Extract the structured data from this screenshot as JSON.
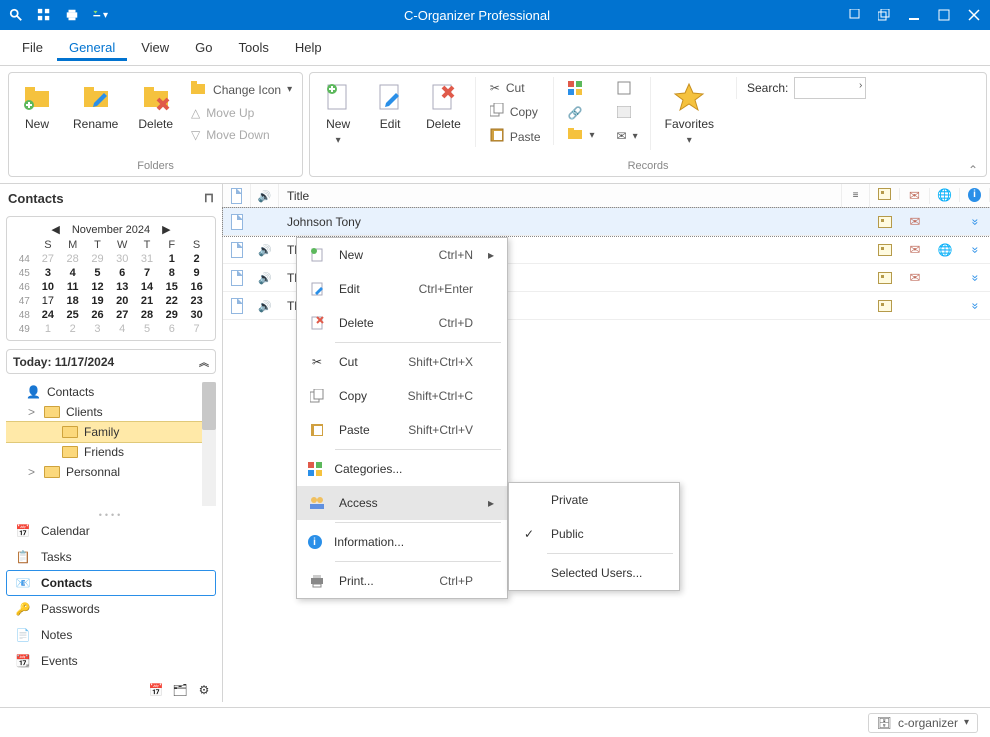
{
  "app": {
    "title": "C-Organizer Professional"
  },
  "menubar": [
    "File",
    "General",
    "View",
    "Go",
    "Tools",
    "Help"
  ],
  "ribbon": {
    "folders": {
      "label": "Folders",
      "new": "New",
      "rename": "Rename",
      "delete": "Delete",
      "change_icon": "Change Icon",
      "move_up": "Move Up",
      "move_down": "Move Down"
    },
    "records": {
      "label": "Records",
      "new": "New",
      "edit": "Edit",
      "delete": "Delete",
      "cut": "Cut",
      "copy": "Copy",
      "paste": "Paste",
      "favorites": "Favorites",
      "search_label": "Search:"
    }
  },
  "sidebar": {
    "header": "Contacts",
    "calendar": {
      "month": "November 2024",
      "dow": [
        "S",
        "M",
        "T",
        "W",
        "T",
        "F",
        "S"
      ],
      "weeks": [
        {
          "wk": "44",
          "days": [
            {
              "d": "27",
              "o": 1
            },
            {
              "d": "28",
              "o": 1
            },
            {
              "d": "29",
              "o": 1
            },
            {
              "d": "30",
              "o": 1
            },
            {
              "d": "31",
              "o": 1
            },
            {
              "d": "1",
              "b": 1
            },
            {
              "d": "2",
              "b": 1
            }
          ]
        },
        {
          "wk": "45",
          "days": [
            {
              "d": "3",
              "b": 1
            },
            {
              "d": "4",
              "b": 1
            },
            {
              "d": "5",
              "b": 1
            },
            {
              "d": "6",
              "b": 1
            },
            {
              "d": "7",
              "b": 1
            },
            {
              "d": "8",
              "b": 1
            },
            {
              "d": "9",
              "b": 1
            }
          ]
        },
        {
          "wk": "46",
          "days": [
            {
              "d": "10",
              "b": 1
            },
            {
              "d": "11",
              "b": 1
            },
            {
              "d": "12",
              "b": 1
            },
            {
              "d": "13",
              "b": 1
            },
            {
              "d": "14",
              "b": 1
            },
            {
              "d": "15",
              "b": 1
            },
            {
              "d": "16",
              "b": 1
            }
          ]
        },
        {
          "wk": "47",
          "days": [
            {
              "d": "17"
            },
            {
              "d": "18",
              "b": 1
            },
            {
              "d": "19",
              "b": 1
            },
            {
              "d": "20",
              "b": 1
            },
            {
              "d": "21",
              "b": 1
            },
            {
              "d": "22",
              "b": 1
            },
            {
              "d": "23",
              "b": 1
            }
          ]
        },
        {
          "wk": "48",
          "days": [
            {
              "d": "24",
              "b": 1
            },
            {
              "d": "25",
              "b": 1
            },
            {
              "d": "26",
              "b": 1
            },
            {
              "d": "27",
              "b": 1
            },
            {
              "d": "28",
              "b": 1
            },
            {
              "d": "29",
              "b": 1
            },
            {
              "d": "30",
              "b": 1
            }
          ]
        },
        {
          "wk": "49",
          "days": [
            {
              "d": "1",
              "o": 1
            },
            {
              "d": "2",
              "o": 1
            },
            {
              "d": "3",
              "o": 1
            },
            {
              "d": "4",
              "o": 1
            },
            {
              "d": "5",
              "o": 1
            },
            {
              "d": "6",
              "o": 1
            },
            {
              "d": "7",
              "o": 1
            }
          ]
        }
      ]
    },
    "today": "Today: 11/17/2024",
    "tree": [
      {
        "label": "Contacts",
        "depth": 0,
        "icon": "contact"
      },
      {
        "label": "Clients",
        "depth": 1,
        "icon": "folder",
        "exp": ">"
      },
      {
        "label": "Family",
        "depth": 2,
        "icon": "folder",
        "sel": true
      },
      {
        "label": "Friends",
        "depth": 2,
        "icon": "folder"
      },
      {
        "label": "Personnal",
        "depth": 1,
        "icon": "folder",
        "exp": ">"
      }
    ],
    "nav": [
      "Calendar",
      "Tasks",
      "Contacts",
      "Passwords",
      "Notes",
      "Events"
    ]
  },
  "grid": {
    "title_col": "Title",
    "rows": [
      {
        "title": "Johnson Tony",
        "sel": true,
        "speaker": false,
        "card": true,
        "env": true,
        "globe": false
      },
      {
        "title": "Th",
        "speaker": true,
        "card": true,
        "env": true,
        "globe": true
      },
      {
        "title": "Th",
        "speaker": true,
        "card": true,
        "env": true,
        "globe": false
      },
      {
        "title": "Th",
        "speaker": true,
        "card": true,
        "env": false,
        "globe": false
      }
    ]
  },
  "ctx": {
    "new": "New",
    "new_s": "Ctrl+N",
    "edit": "Edit",
    "edit_s": "Ctrl+Enter",
    "delete": "Delete",
    "delete_s": "Ctrl+D",
    "cut": "Cut",
    "cut_s": "Shift+Ctrl+X",
    "copy": "Copy",
    "copy_s": "Shift+Ctrl+C",
    "paste": "Paste",
    "paste_s": "Shift+Ctrl+V",
    "categories": "Categories...",
    "access": "Access",
    "information": "Information...",
    "print": "Print...",
    "print_s": "Ctrl+P"
  },
  "submenu": {
    "private": "Private",
    "public": "Public",
    "selected": "Selected Users..."
  },
  "status": {
    "db": "c-organizer"
  }
}
